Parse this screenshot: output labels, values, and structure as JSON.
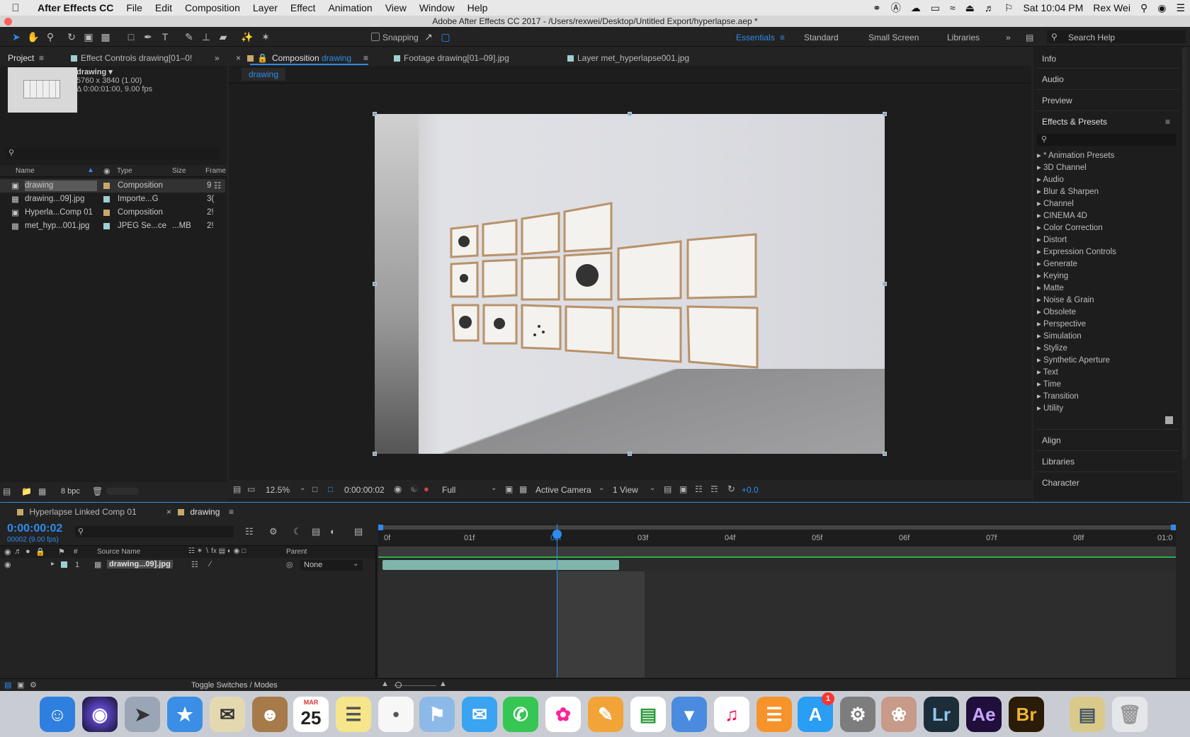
{
  "menubar": {
    "app_name": "After Effects CC",
    "items": [
      "File",
      "Edit",
      "Composition",
      "Layer",
      "Effect",
      "Animation",
      "View",
      "Window",
      "Help"
    ],
    "clock": "Sat 10:04 PM",
    "user": "Rex Wei"
  },
  "window_title": "Adobe After Effects CC 2017 - /Users/rexwei/Desktop/Untitled Export/hyperlapse.aep *",
  "toolbar": {
    "snapping_label": "Snapping",
    "workspaces": [
      "Essentials",
      "Standard",
      "Small Screen",
      "Libraries"
    ],
    "active_workspace": "Essentials",
    "search_placeholder": "Search Help"
  },
  "project_panel": {
    "tab_label": "Project",
    "effect_controls_tab": "Effect Controls drawing[01–0!",
    "thumb_name": "drawing ▾",
    "thumb_dims": "5760 x 3840 (1.00)",
    "thumb_duration": "Δ 0:00:01:00, 9.00 fps",
    "columns": [
      "Name",
      "Type",
      "Size",
      "Frame"
    ],
    "rows": [
      {
        "name": "drawing",
        "type": "Composition",
        "size": "",
        "frame": "9",
        "color": "#c8a86a"
      },
      {
        "name": "drawing...09].jpg",
        "type": "Importe...G",
        "size": "",
        "frame": "3(",
        "color": "#9ecfcf"
      },
      {
        "name": "Hyperla...Comp 01",
        "type": "Composition",
        "size": "",
        "frame": "2!",
        "color": "#c8a86a"
      },
      {
        "name": "met_hyp...001.jpg",
        "type": "JPEG Se...ce",
        "size": "...MB",
        "frame": "2!",
        "color": "#9ecfcf"
      }
    ],
    "bpc_label": "8 bpc"
  },
  "comp_panel": {
    "tab_comp": "Composition",
    "tab_comp_name": "drawing",
    "tab_footage": "Footage drawing[01–09].jpg",
    "tab_layer": "Layer met_hyperlapse001.jpg",
    "breadcrumb": "drawing",
    "zoom": "12.5%",
    "timecode": "0:00:00:02",
    "resolution": "Full",
    "camera": "Active Camera",
    "views": "1 View",
    "exposure": "+0.0"
  },
  "right_panel": {
    "panels_top": [
      "Info",
      "Audio",
      "Preview"
    ],
    "effects_title": "Effects & Presets",
    "effects": [
      "* Animation Presets",
      "3D Channel",
      "Audio",
      "Blur & Sharpen",
      "Channel",
      "CINEMA 4D",
      "Color Correction",
      "Distort",
      "Expression Controls",
      "Generate",
      "Keying",
      "Matte",
      "Noise & Grain",
      "Obsolete",
      "Perspective",
      "Simulation",
      "Stylize",
      "Synthetic Aperture",
      "Text",
      "Time",
      "Transition",
      "Utility"
    ],
    "panels_bottom": [
      "Align",
      "Libraries",
      "Character"
    ]
  },
  "timeline": {
    "tab_other": "Hyperlapse Linked Comp 01",
    "tab_active": "drawing",
    "current_time": "0:00:00:02",
    "frame_info": "00002 (9.00 fps)",
    "col_source": "Source Name",
    "col_parent": "Parent",
    "layer_num": "1",
    "layer_name": "drawing...09].jpg",
    "parent_value": "None",
    "ruler": [
      "0f",
      "01f",
      "02f",
      "03f",
      "04f",
      "05f",
      "06f",
      "07f",
      "08f",
      "01:0"
    ],
    "toggle_label": "Toggle Switches / Modes"
  },
  "dock": {
    "calendar_month": "MAR",
    "calendar_day": "25",
    "appstore_badge": "1",
    "lr_label": "Lr",
    "ae_label": "Ae",
    "br_label": "Br"
  }
}
